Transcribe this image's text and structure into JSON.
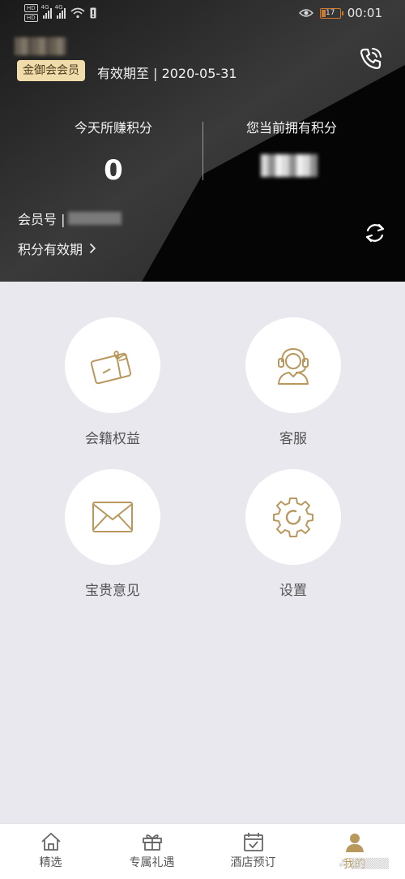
{
  "status_bar": {
    "network_left": "4G",
    "network_right": "4G",
    "battery_level": "17",
    "time": "00:01",
    "hd_label": "HD"
  },
  "member": {
    "tier_badge": "金御会会员",
    "valid_until": "有效期至 | 2020-05-31"
  },
  "points": {
    "today_label": "今天所赚积分",
    "today_value": "0",
    "current_label": "您当前拥有积分"
  },
  "member_no_label": "会员号 |",
  "points_validity_link": "积分有效期",
  "grid": [
    {
      "label": "会籍权益",
      "icon": "gift-card-icon"
    },
    {
      "label": "客服",
      "icon": "headset-icon"
    },
    {
      "label": "宝贵意见",
      "icon": "envelope-icon"
    },
    {
      "label": "设置",
      "icon": "gear-icon"
    }
  ],
  "nav": [
    {
      "label": "精选",
      "icon": "home-icon"
    },
    {
      "label": "专属礼遇",
      "icon": "gift-icon"
    },
    {
      "label": "酒店预订",
      "icon": "calendar-check-icon"
    },
    {
      "label": "我的",
      "icon": "person-icon",
      "active": true
    }
  ],
  "colors": {
    "accent_gold": "#b9985e",
    "badge_bg": "#efdcaa",
    "header_bg": "#050505",
    "page_bg": "#e9e8ee"
  }
}
